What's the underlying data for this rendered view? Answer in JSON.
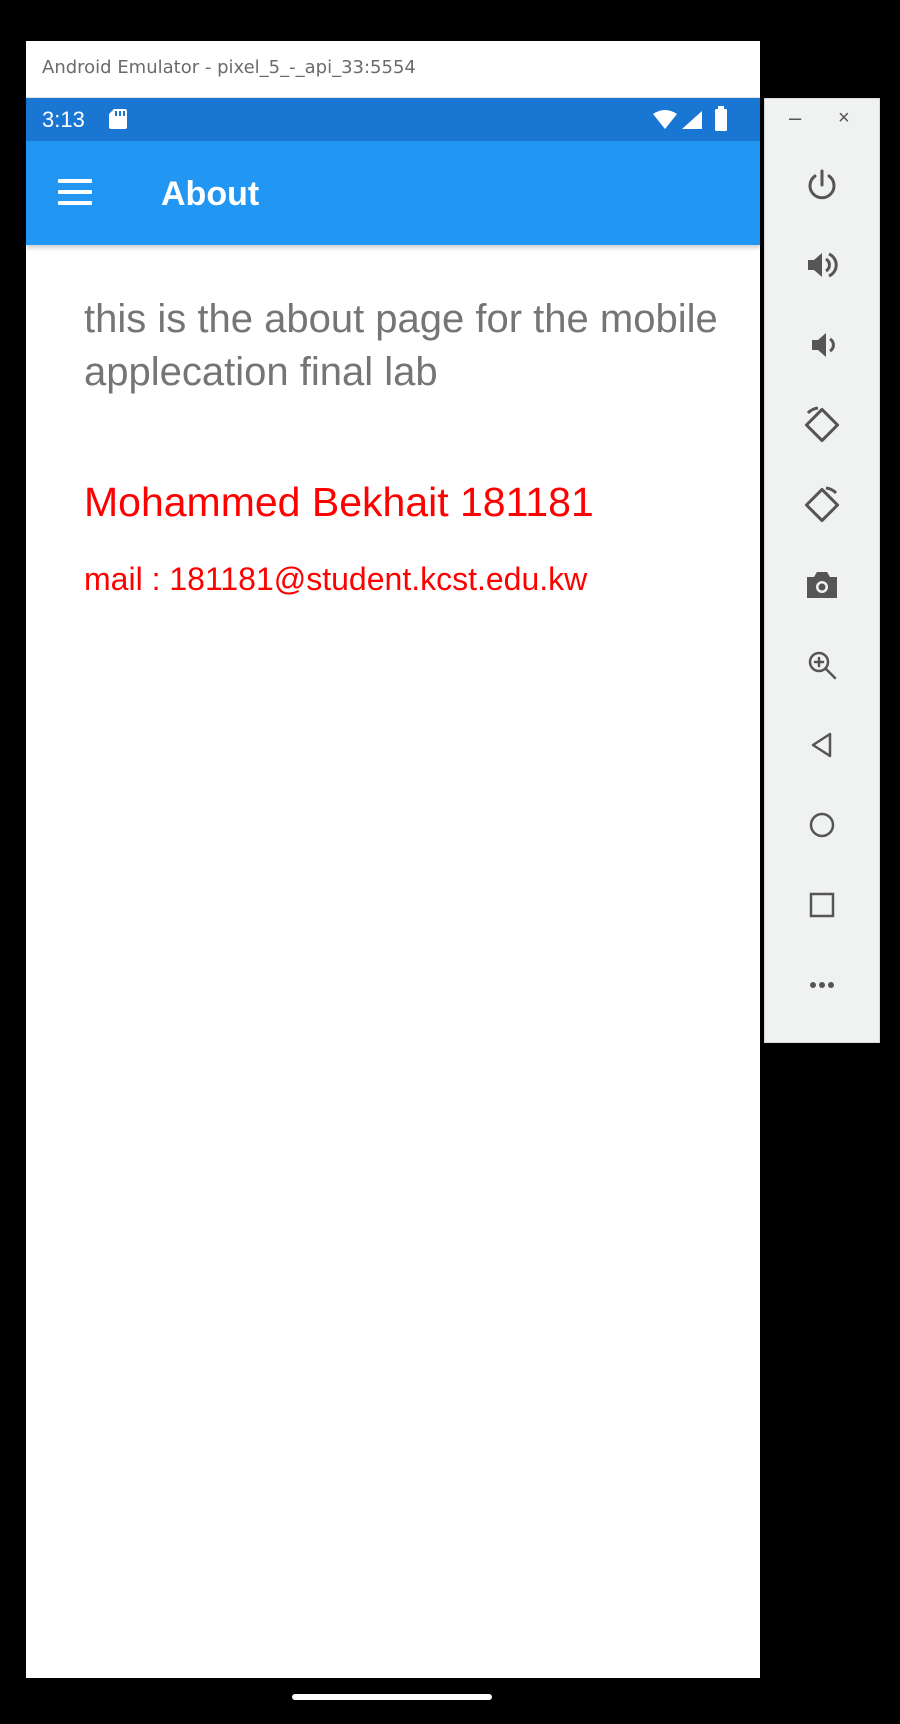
{
  "window": {
    "title": "Android Emulator - pixel_5_-_api_33:5554",
    "minimize_glyph": "–",
    "close_glyph": "×"
  },
  "status_bar": {
    "time": "3:13",
    "icons": [
      "sd-card-icon",
      "wifi-icon",
      "signal-icon",
      "battery-icon"
    ],
    "color": "#1976d2"
  },
  "app_bar": {
    "title": "About",
    "menu_icon": "hamburger-menu-icon",
    "color": "#2196f3"
  },
  "content": {
    "about_text": "this is the about page for the mobile applecation final lab",
    "author_name": "Mohammed Bekhait 181181",
    "author_mail": "mail : 181181@student.kcst.edu.kw",
    "author_color": "#ff0000",
    "text_color": "#757575"
  },
  "side_toolbar": {
    "buttons": [
      "power-icon",
      "volume-up-icon",
      "volume-down-icon",
      "rotate-left-icon",
      "rotate-right-icon",
      "camera-icon",
      "zoom-icon",
      "back-icon",
      "home-icon",
      "overview-icon",
      "more-icon"
    ]
  }
}
